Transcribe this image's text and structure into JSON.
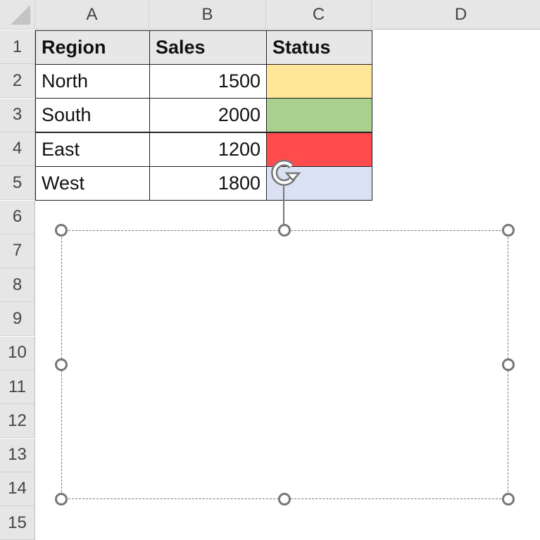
{
  "columns": [
    "A",
    "B",
    "C",
    "D"
  ],
  "rows": [
    "1",
    "2",
    "3",
    "4",
    "5",
    "6",
    "7",
    "8",
    "9",
    "10",
    "11",
    "12",
    "13",
    "14",
    "15"
  ],
  "table": {
    "headers": [
      "Region",
      "Sales",
      "Status"
    ],
    "data": [
      {
        "region": "North",
        "sales": "1500",
        "status_color": "#FFE699"
      },
      {
        "region": "South",
        "sales": "2000",
        "status_color": "#A9D08E"
      },
      {
        "region": "East",
        "sales": "1200",
        "status_color": "#FF4B4B"
      },
      {
        "region": "West",
        "sales": "1800",
        "status_color": "#D9E1F2"
      }
    ]
  }
}
